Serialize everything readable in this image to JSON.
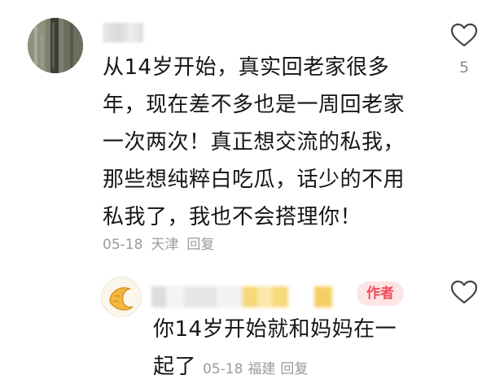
{
  "comment": {
    "lines": [
      "从14岁开始，真实回老家很多",
      "年，现在差不多也是一周回老家",
      "一次两次！真正想交流的私我，",
      "那些想纯粹白吃瓜，话少的不用",
      "私我了，我也不会搭理你！"
    ],
    "date": "05-18",
    "location": "天津",
    "reply_label": "回复",
    "like_count": "5",
    "heart_icon": "heart-outline-icon"
  },
  "reply": {
    "badge": "作者",
    "lines": [
      "你14岁开始就和妈妈在一",
      "起了"
    ],
    "date": "05-18",
    "location": "福建",
    "reply_label": "回复",
    "heart_icon": "heart-outline-icon",
    "avatar_icon": "croissant-icon",
    "badge_color": "#f04b55"
  }
}
